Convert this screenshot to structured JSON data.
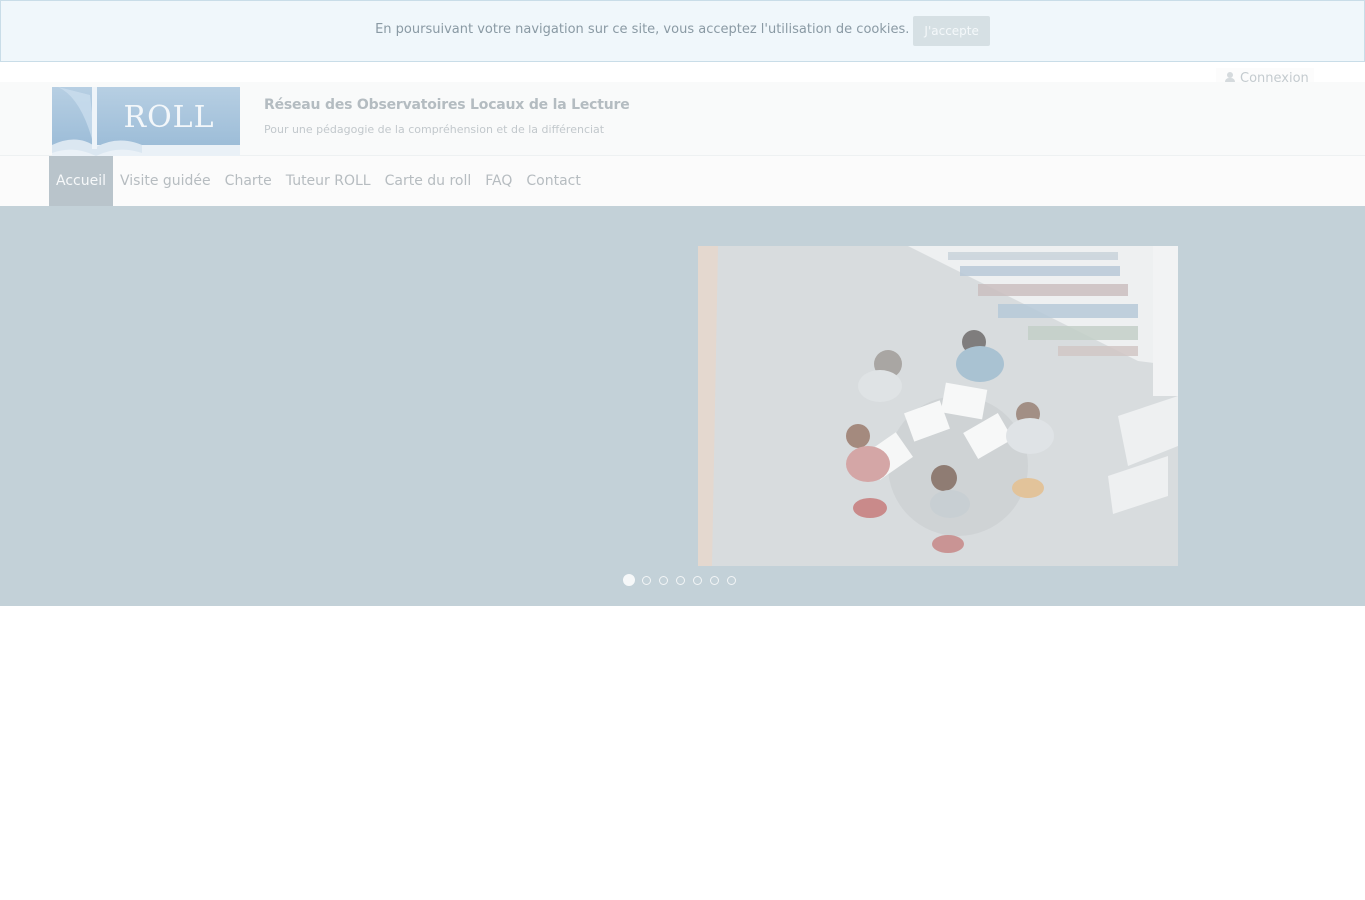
{
  "cookie_banner": {
    "text": "En poursuivant votre navigation sur ce site, vous acceptez l'utilisation de cookies.",
    "accept_label": "J'accepte"
  },
  "top_bar": {
    "login_label": "Connexion",
    "login_icon": "user-icon"
  },
  "header": {
    "logo_text": "ROLL",
    "title": "Réseau des Observatoires Locaux de la Lecture",
    "subtitle": "Pour une pédagogie de la compréhension et de la différenciati"
  },
  "nav": {
    "items": [
      {
        "label": "Accueil",
        "active": true
      },
      {
        "label": "Visite guidée"
      },
      {
        "label": "Charte"
      },
      {
        "label": "Tuteur ROLL"
      },
      {
        "label": "Carte du roll"
      },
      {
        "label": "FAQ"
      },
      {
        "label": "Contact"
      }
    ]
  },
  "carousel": {
    "slide_count": 7,
    "active_index": 0
  },
  "colors": {
    "hero_bg": "#c3d1d8",
    "active_nav_bg": "#b9c4cb",
    "cookie_bg": "#f0f7fb"
  }
}
